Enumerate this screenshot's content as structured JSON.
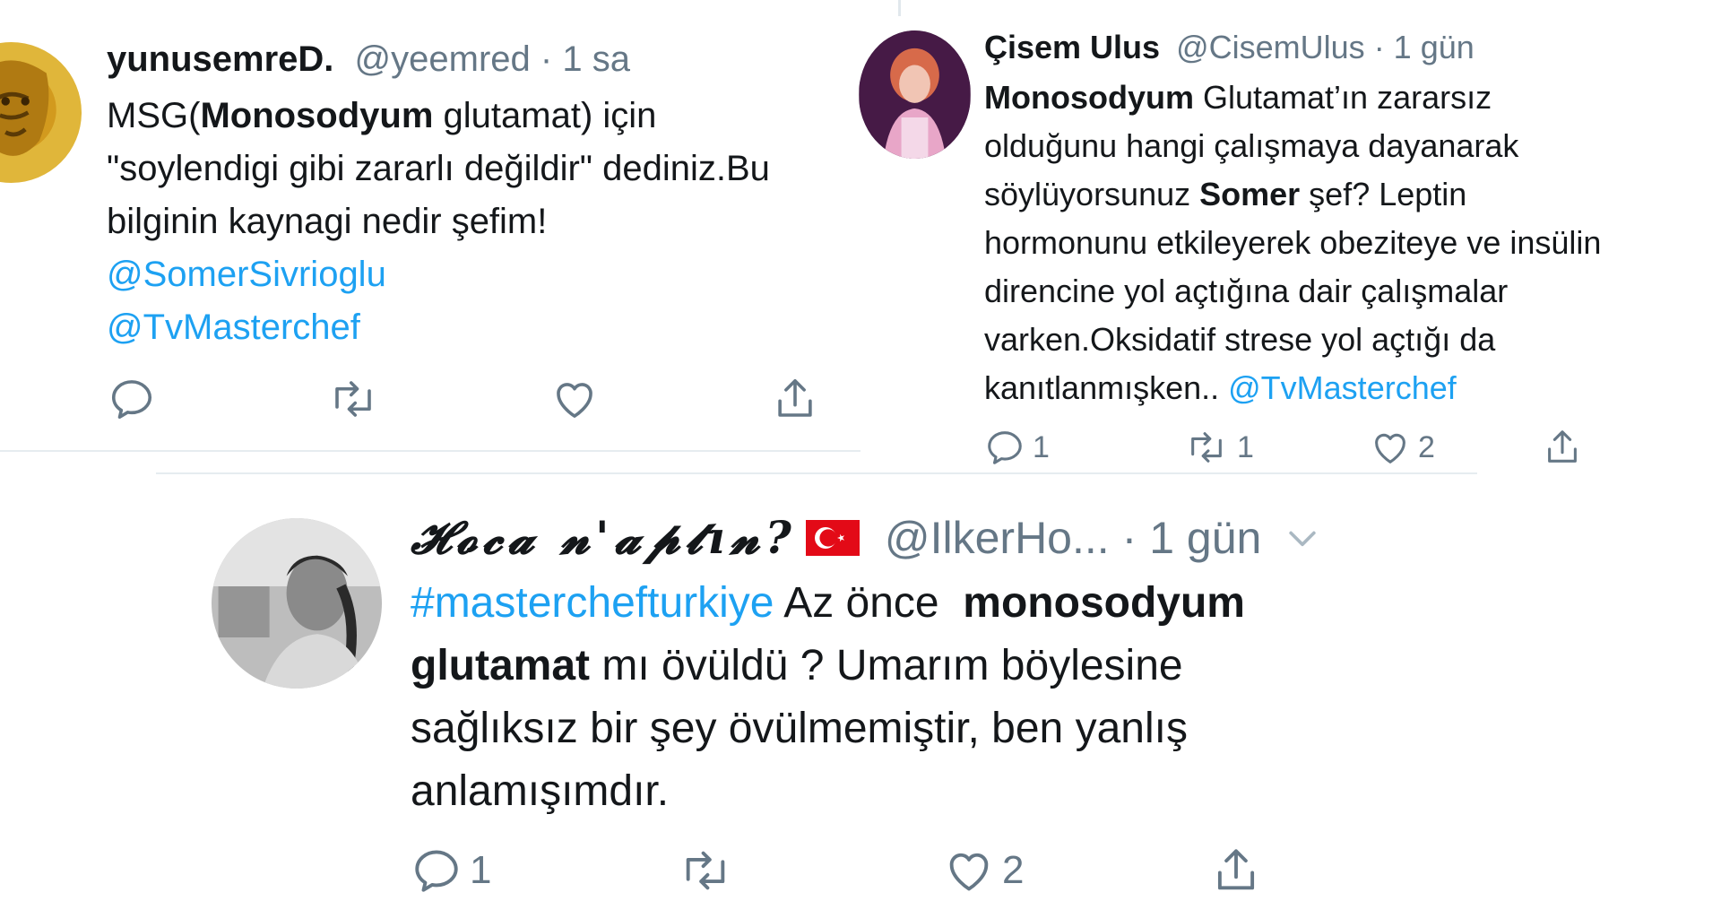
{
  "tweet1": {
    "name": "yunusemreD.",
    "handle": "@yeemred",
    "time": "· 1 sa",
    "line1_pre": "MSG(",
    "line1_bold": "Monosodyum",
    "line1_post": " glutamat) için",
    "line2": "\"soylendigi gibi zararlı değildir\" dediniz.Bu",
    "line3": "bilginin kaynagi nedir şefim!",
    "mention1": "@SomerSivrioglu",
    "mention2": "@TvMasterchef",
    "icons": [
      "reply-icon",
      "retweet-icon",
      "like-icon",
      "share-icon"
    ]
  },
  "tweet2": {
    "name": "Çisem Ulus",
    "handle": "@CisemUlus",
    "time": "· 1 gün",
    "line1_bold": "Monosodyum",
    "line1_post": " Glutamat’ın zararsız",
    "line2": "olduğunu hangi çalışmaya dayanarak",
    "line3_pre": "söylüyorsunuz ",
    "line3_bold": "Somer",
    "line3_post": " şef? Leptin",
    "line4": "hormonunu etkileyerek obeziteye ve insülin",
    "line5": "direncine yol açtığına dair çalışmalar",
    "line6": "varken.Oksidatif strese yol açtığı da",
    "line7_pre": "kanıtlanmışken.. ",
    "line7_link": "@TvMasterchef",
    "reply_count": "1",
    "retweet_count": "1",
    "like_count": "2"
  },
  "tweet3": {
    "name": "𝓗𝓸𝓬𝓪 𝓷'𝓪𝓹𝓽ı𝓷?",
    "flag": "🇹🇷",
    "handle": "@IlkerHo...",
    "time": "· 1 gün",
    "hashtag": "#masterchefturkiye",
    "line1_post": " Az önce  ",
    "line1_bold": "monosodyum",
    "line2_bold": "glutamat",
    "line2_post": " mı övüldü ? Umarım böylesine",
    "line3": "sağlıksız bir şey övülmemiştir, ben yanlış",
    "line4": "anlamışımdır.",
    "reply_count": "1",
    "like_count": "2"
  },
  "colors": {
    "text": "#14171a",
    "meta": "#657786",
    "link": "#1da1f2",
    "divider": "#e6ecf0"
  }
}
